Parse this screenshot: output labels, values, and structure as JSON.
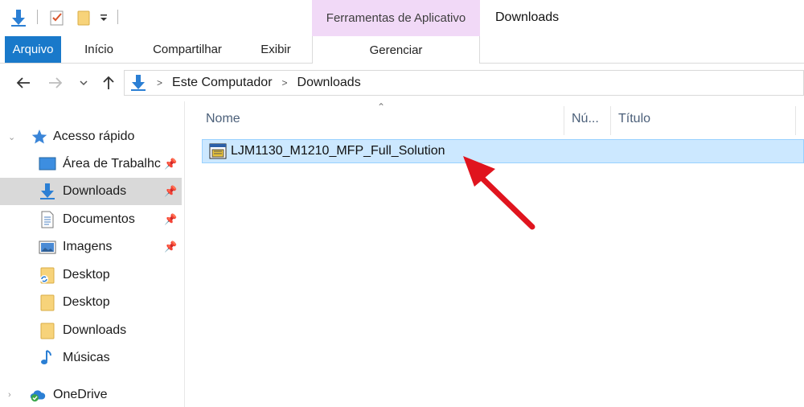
{
  "window": {
    "title": "Downloads"
  },
  "ribbon": {
    "context_group": "Ferramentas de Aplicativo",
    "context_tab": "Gerenciar",
    "tabs": [
      "Arquivo",
      "Início",
      "Compartilhar",
      "Exibir"
    ]
  },
  "address": {
    "crumbs": [
      "Este Computador",
      "Downloads"
    ]
  },
  "nav": {
    "quick_access": "Acesso rápido",
    "items": [
      {
        "label": "Área de Trabalhc",
        "icon": "desktop-icon",
        "pinned": true
      },
      {
        "label": "Downloads",
        "icon": "download-arrow-icon",
        "pinned": true,
        "selected": true
      },
      {
        "label": "Documentos",
        "icon": "document-icon",
        "pinned": true
      },
      {
        "label": "Imagens",
        "icon": "pictures-icon",
        "pinned": true
      },
      {
        "label": "Desktop",
        "icon": "sync-folder-icon",
        "pinned": false
      },
      {
        "label": "Desktop",
        "icon": "folder-icon",
        "pinned": false
      },
      {
        "label": "Downloads",
        "icon": "folder-icon",
        "pinned": false
      },
      {
        "label": "Músicas",
        "icon": "music-icon",
        "pinned": false
      }
    ],
    "onedrive": "OneDrive"
  },
  "columns": {
    "name": "Nome",
    "number": "Nú...",
    "title": "Título"
  },
  "files": [
    {
      "name": "LJM1130_M1210_MFP_Full_Solution",
      "icon": "installer-icon",
      "selected": true
    }
  ],
  "colors": {
    "file_tab": "#1979ca",
    "context_tab": "#f1d9f7",
    "selection": "#cce8ff",
    "selection_border": "#99d1ff",
    "nav_selected": "#d9d9d9",
    "annotation_arrow": "#e0141e"
  }
}
